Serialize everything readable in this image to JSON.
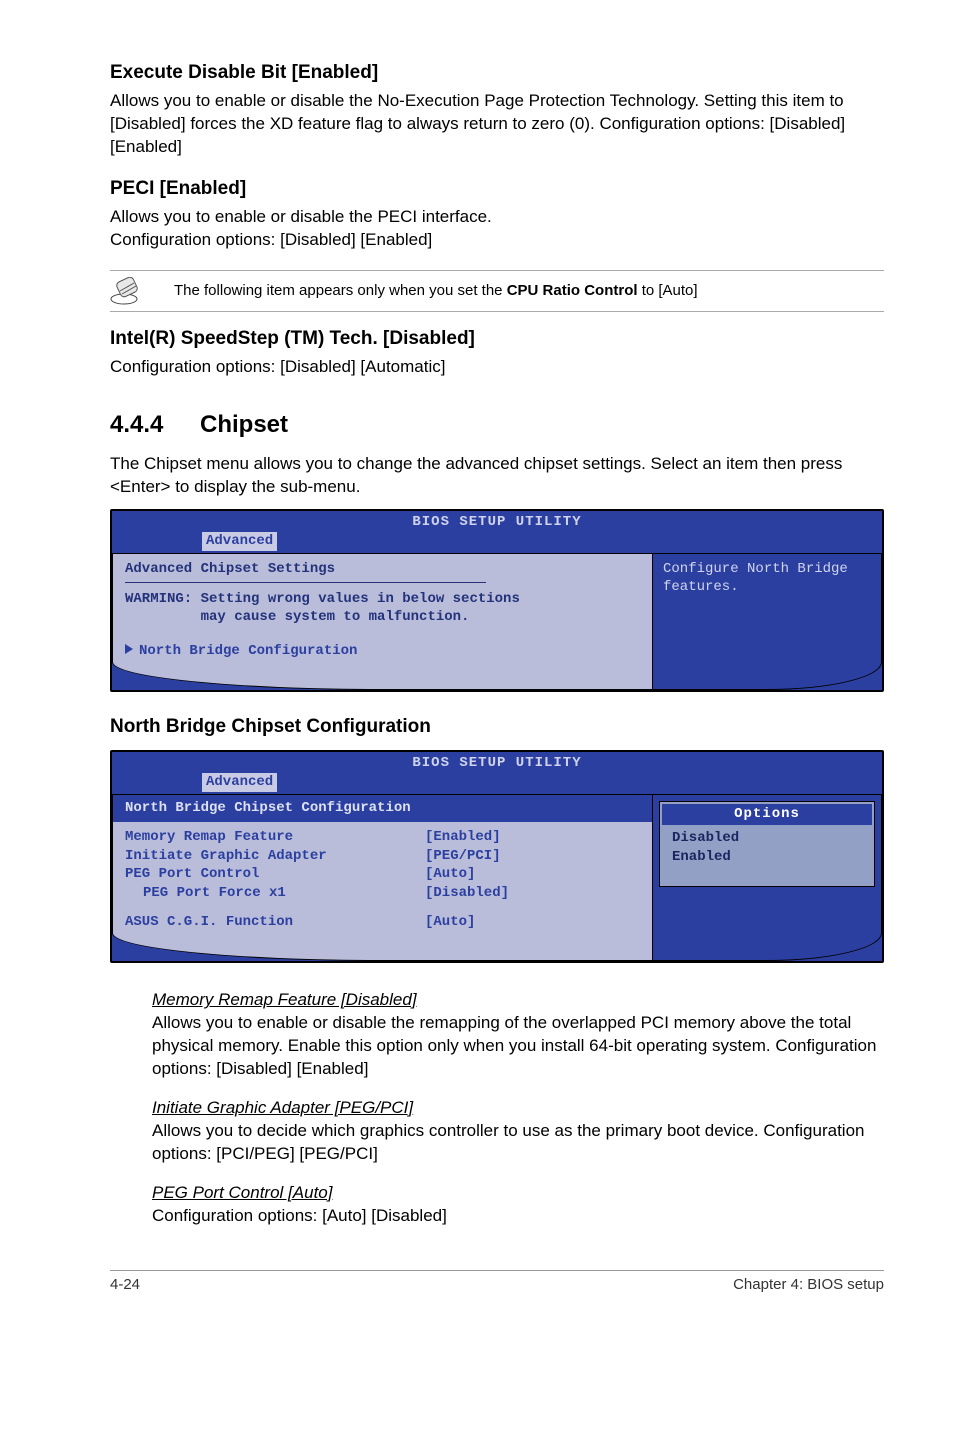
{
  "sec1": {
    "title": "Execute Disable Bit [Enabled]",
    "body": "Allows you to enable or disable the No-Execution Page Protection Technology. Setting this item to [Disabled] forces the XD feature flag to always return to zero (0). Configuration options: [Disabled] [Enabled]"
  },
  "sec2": {
    "title": "PECI [Enabled]",
    "body1": "Allows you to enable or disable the PECI interface.",
    "body2": "Configuration options: [Disabled] [Enabled]"
  },
  "note": {
    "text_pre": "The following item appears only when you set the ",
    "bold": "CPU Ratio Control",
    "text_post": " to [Auto]"
  },
  "sec3": {
    "title": "Intel(R) SpeedStep (TM) Tech. [Disabled]",
    "body": "Configuration options: [Disabled] [Automatic]"
  },
  "chipset": {
    "num": "4.4.4",
    "title": "Chipset",
    "intro": "The Chipset menu allows you to change the advanced chipset settings. Select an item then press <Enter> to display the sub-menu."
  },
  "bios1": {
    "title": "BIOS SETUP UTILITY",
    "tab": "Advanced",
    "heading": "Advanced Chipset Settings",
    "warning": "WARMING: Setting wrong values in below sections\n         may cause system to malfunction.",
    "link": "North Bridge Configuration",
    "help": "Configure North Bridge features."
  },
  "nbheading": "North Bridge Chipset Configuration",
  "bios2": {
    "title": "BIOS SETUP UTILITY",
    "tab": "Advanced",
    "heading": "North Bridge Chipset Configuration",
    "rows": [
      {
        "label": "Memory Remap Feature",
        "value": "[Enabled]"
      },
      {
        "label": "Initiate Graphic Adapter",
        "value": "[PEG/PCI]"
      },
      {
        "label": "PEG Port Control",
        "value": "[Auto]"
      },
      {
        "label": "PEG Port Force x1",
        "value": "[Disabled]",
        "indent": true
      }
    ],
    "row_last": {
      "label": "ASUS C.G.I. Function",
      "value": "[Auto]"
    },
    "options_title": "Options",
    "options": [
      "Disabled",
      "Enabled"
    ]
  },
  "sub1": {
    "u": "Memory Remap Feature [Disabled]",
    "body": "Allows you to enable or disable the remapping of the overlapped PCI memory above the total physical memory. Enable this option only when you install 64-bit operating system. Configuration options: [Disabled] [Enabled]"
  },
  "sub2": {
    "u": "Initiate Graphic Adapter [PEG/PCI]",
    "body": "Allows you to decide which graphics controller to use as the primary boot device. Configuration options: [PCI/PEG] [PEG/PCI]"
  },
  "sub3": {
    "u": "PEG Port Control [Auto]",
    "body": "Configuration options: [Auto] [Disabled]"
  },
  "footer": {
    "left": "4-24",
    "right": "Chapter 4: BIOS setup"
  }
}
